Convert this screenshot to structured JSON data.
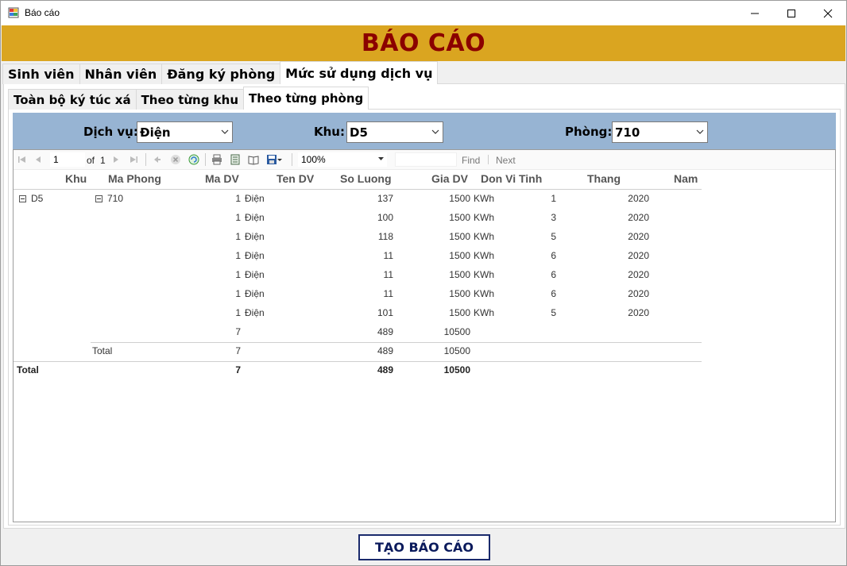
{
  "window": {
    "title": "Báo cáo"
  },
  "header": {
    "title": "BÁO CÁO"
  },
  "tabs_main": [
    "Sinh viên",
    "Nhân viên",
    "Đăng ký phòng",
    "Mức sử dụng dịch vụ"
  ],
  "tabs_sub": [
    "Toàn bộ ký túc xá",
    "Theo từng khu",
    "Theo từng phòng"
  ],
  "filters": {
    "service_label": "Dịch vụ:",
    "service_value": "Điện",
    "zone_label": "Khu:",
    "zone_value": "D5",
    "room_label": "Phòng:",
    "room_value": "710"
  },
  "toolbar": {
    "page": "1",
    "of_label": "of",
    "total_pages": "1",
    "zoom": "100%",
    "find_label": "Find",
    "next_label": "Next"
  },
  "report": {
    "columns": [
      "Khu",
      "Ma Phong",
      "Ma DV",
      "Ten DV",
      "So Luong",
      "Gia DV",
      "Don Vi Tinh",
      "Thang",
      "Nam"
    ],
    "zone": "D5",
    "room": "710",
    "rows": [
      {
        "ma_dv": "1",
        "ten_dv": "Điện",
        "so_luong": "137",
        "gia_dv": "1500",
        "dvt": "KWh",
        "thang": "1",
        "nam": "2020"
      },
      {
        "ma_dv": "1",
        "ten_dv": "Điện",
        "so_luong": "100",
        "gia_dv": "1500",
        "dvt": "KWh",
        "thang": "3",
        "nam": "2020"
      },
      {
        "ma_dv": "1",
        "ten_dv": "Điện",
        "so_luong": "118",
        "gia_dv": "1500",
        "dvt": "KWh",
        "thang": "5",
        "nam": "2020"
      },
      {
        "ma_dv": "1",
        "ten_dv": "Điện",
        "so_luong": "11",
        "gia_dv": "1500",
        "dvt": "KWh",
        "thang": "6",
        "nam": "2020"
      },
      {
        "ma_dv": "1",
        "ten_dv": "Điện",
        "so_luong": "11",
        "gia_dv": "1500",
        "dvt": "KWh",
        "thang": "6",
        "nam": "2020"
      },
      {
        "ma_dv": "1",
        "ten_dv": "Điện",
        "so_luong": "11",
        "gia_dv": "1500",
        "dvt": "KWh",
        "thang": "6",
        "nam": "2020"
      },
      {
        "ma_dv": "1",
        "ten_dv": "Điện",
        "so_luong": "101",
        "gia_dv": "1500",
        "dvt": "KWh",
        "thang": "5",
        "nam": "2020"
      }
    ],
    "room_subtotal": {
      "ma_dv": "7",
      "so_luong": "489",
      "gia_dv": "10500"
    },
    "zone_total": {
      "label": "Total",
      "ma_dv": "7",
      "so_luong": "489",
      "gia_dv": "10500"
    },
    "grand_total": {
      "label": "Total",
      "ma_dv": "7",
      "so_luong": "489",
      "gia_dv": "10500"
    }
  },
  "button": {
    "create_label": "TẠO BÁO CÁO"
  }
}
